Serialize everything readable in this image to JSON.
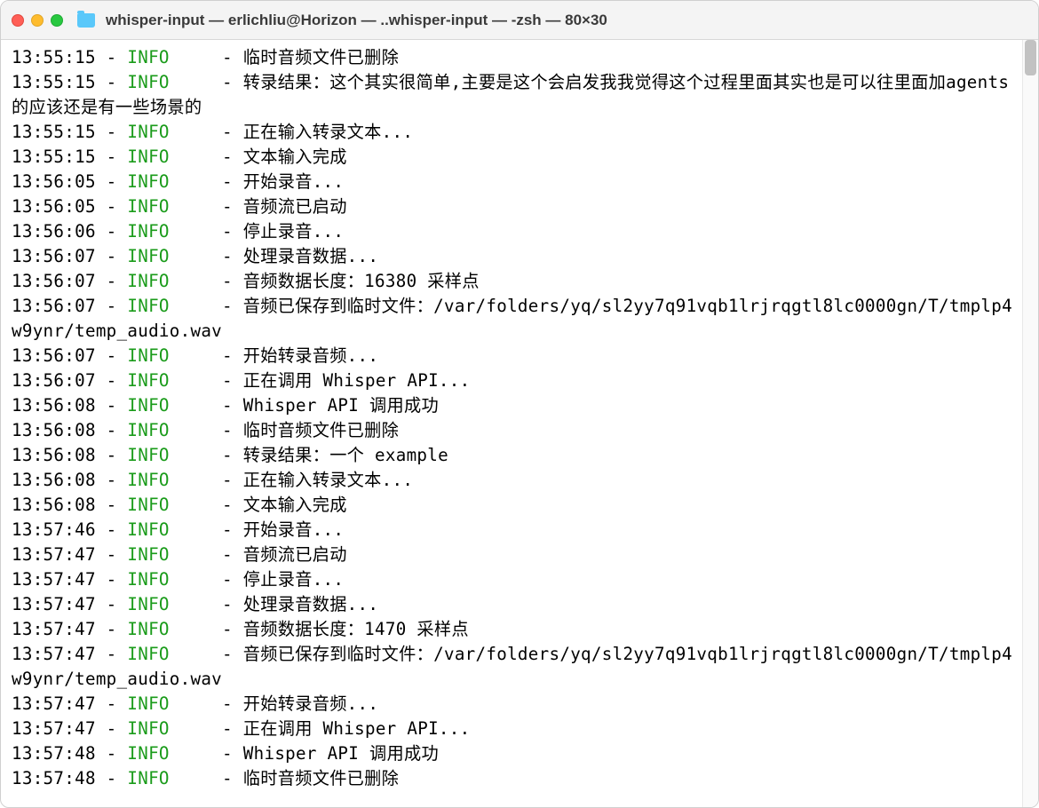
{
  "window": {
    "title": "whisper-input — erlichliu@Horizon — ..whisper-input — -zsh — 80×30"
  },
  "log": {
    "level_label": "INFO",
    "entries": [
      {
        "time": "13:55:15",
        "msg": "临时音频文件已删除"
      },
      {
        "time": "13:55:15",
        "msg": "转录结果：这个其实很简单,主要是这个会启发我我觉得这个过程里面其实也是可以往里面加agents的应该还是有一些场景的",
        "wrap": true
      },
      {
        "time": "13:55:15",
        "msg": "正在输入转录文本..."
      },
      {
        "time": "13:55:15",
        "msg": "文本输入完成"
      },
      {
        "time": "13:56:05",
        "msg": "开始录音..."
      },
      {
        "time": "13:56:05",
        "msg": "音频流已启动"
      },
      {
        "time": "13:56:06",
        "msg": "停止录音..."
      },
      {
        "time": "13:56:07",
        "msg": "处理录音数据..."
      },
      {
        "time": "13:56:07",
        "msg": "音频数据长度：16380 采样点"
      },
      {
        "time": "13:56:07",
        "msg": "音频已保存到临时文件：/var/folders/yq/sl2yy7q91vqb1lrjrqgtl8lc0000gn/T/tmplp4w9ynr/temp_audio.wav",
        "wrap": true
      },
      {
        "time": "13:56:07",
        "msg": "开始转录音频..."
      },
      {
        "time": "13:56:07",
        "msg": "正在调用 Whisper API..."
      },
      {
        "time": "13:56:08",
        "msg": "Whisper API 调用成功"
      },
      {
        "time": "13:56:08",
        "msg": "临时音频文件已删除"
      },
      {
        "time": "13:56:08",
        "msg": "转录结果：一个 example"
      },
      {
        "time": "13:56:08",
        "msg": "正在输入转录文本..."
      },
      {
        "time": "13:56:08",
        "msg": "文本输入完成"
      },
      {
        "time": "13:57:46",
        "msg": "开始录音..."
      },
      {
        "time": "13:57:47",
        "msg": "音频流已启动"
      },
      {
        "time": "13:57:47",
        "msg": "停止录音..."
      },
      {
        "time": "13:57:47",
        "msg": "处理录音数据..."
      },
      {
        "time": "13:57:47",
        "msg": "音频数据长度：1470 采样点"
      },
      {
        "time": "13:57:47",
        "msg": "音频已保存到临时文件：/var/folders/yq/sl2yy7q91vqb1lrjrqgtl8lc0000gn/T/tmplp4w9ynr/temp_audio.wav",
        "wrap": true
      },
      {
        "time": "13:57:47",
        "msg": "开始转录音频..."
      },
      {
        "time": "13:57:47",
        "msg": "正在调用 Whisper API..."
      },
      {
        "time": "13:57:48",
        "msg": "Whisper API 调用成功"
      },
      {
        "time": "13:57:48",
        "msg": "临时音频文件已删除"
      }
    ]
  }
}
